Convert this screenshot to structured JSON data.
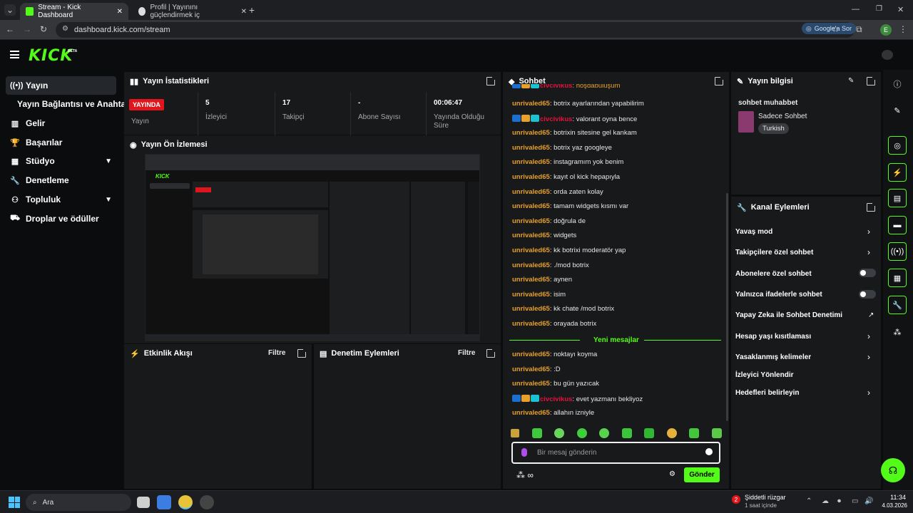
{
  "browser": {
    "tabs": [
      {
        "label": "Stream - Kick Dashboard"
      },
      {
        "label": "Profil | Yayınını güçlendirmek iç"
      }
    ],
    "new_tab": "+",
    "url": "dashboard.kick.com/stream",
    "google_chip": "Google'a Sor",
    "profile_initial": "E"
  },
  "brand": {
    "logo": "KICK",
    "beta": "BETA",
    "accent": "#53fc18"
  },
  "sidebar": {
    "items": [
      {
        "label": "Yayın",
        "icon": "broadcast-icon"
      },
      {
        "label": "Yayın Bağlantısı ve Anahtarı"
      },
      {
        "label": "Gelir",
        "icon": "revenue-icon"
      },
      {
        "label": "Başarılar",
        "icon": "trophy-icon"
      },
      {
        "label": "Stüdyo",
        "icon": "studio-icon"
      },
      {
        "label": "Denetleme",
        "icon": "wrench-icon"
      },
      {
        "label": "Topluluk",
        "icon": "community-icon"
      },
      {
        "label": "Droplar ve ödüller",
        "icon": "drops-icon"
      }
    ]
  },
  "stats": {
    "title": "Yayın İstatistikleri",
    "live_badge": "YAYINDA",
    "live_label": "Yayın",
    "viewers_value": "5",
    "viewers_label": "İzleyici",
    "followers_value": "17",
    "followers_label": "Takipçi",
    "subs_value": "-",
    "subs_label": "Abone Sayısı",
    "uptime_value": "00:06:47",
    "uptime_label": "Yayında Olduğu Süre"
  },
  "preview": {
    "title": "Yayın Ön İzlemesi"
  },
  "activity": {
    "title": "Etkinlik Akışı",
    "filter": "Filtre"
  },
  "moderation": {
    "title": "Denetim Eylemleri",
    "filter": "Filtre"
  },
  "chat": {
    "title": "Sohbet",
    "messages": [
      {
        "user": "unrivaled65",
        "text": ": botrix ayarlarından yapabilirim",
        "badges": false
      },
      {
        "user": "civcivikus",
        "text": ": valorant oyna bence",
        "badges": true
      },
      {
        "user": "unrivaled65",
        "text": ": botrixin sitesine gel kankam",
        "badges": false
      },
      {
        "user": "unrivaled65",
        "text": ": botrix yaz googleye",
        "badges": false
      },
      {
        "user": "unrivaled65",
        "text": ": instagramım yok benim",
        "badges": false
      },
      {
        "user": "unrivaled65",
        "text": ": kayıt ol kick hepapıyla",
        "badges": false
      },
      {
        "user": "unrivaled65",
        "text": ": orda zaten kolay",
        "badges": false
      },
      {
        "user": "unrivaled65",
        "text": ": tamam widgets kısmı var",
        "badges": false
      },
      {
        "user": "unrivaled65",
        "text": ": doğrula de",
        "badges": false
      },
      {
        "user": "unrivaled65",
        "text": ": widgets",
        "badges": false
      },
      {
        "user": "unrivaled65",
        "text": ": kk botrixi moderatör yap",
        "badges": false
      },
      {
        "user": "unrivaled65",
        "text": ": ./mod botrix",
        "badges": false
      },
      {
        "user": "unrivaled65",
        "text": ": aynen",
        "badges": false
      },
      {
        "user": "unrivaled65",
        "text": ": isim",
        "badges": false
      },
      {
        "user": "unrivaled65",
        "text": ": kk chate /mod botrix",
        "badges": false
      },
      {
        "user": "unrivaled65",
        "text": ": orayada botrix",
        "badges": false
      }
    ],
    "new_messages": "Yeni mesajlar",
    "messages_after": [
      {
        "user": "unrivaled65",
        "text": ": noktayı koyma",
        "badges": false
      },
      {
        "user": "unrivaled65",
        "text": ": :D",
        "badges": false
      },
      {
        "user": "unrivaled65",
        "text": ": bu gün yazıcak",
        "badges": false
      },
      {
        "user": "civcivikus",
        "text": ": evet yazmanı bekliyoz",
        "badges": true
      },
      {
        "user": "unrivaled65",
        "text": ": allahın izniyle",
        "badges": false
      }
    ],
    "placeholder": "Bir mesaj gönderin",
    "send": "Gönder"
  },
  "stream_info": {
    "title": "Yayın bilgisi",
    "stream_title": "sohbet muhabbet",
    "category": "Sadece Sohbet",
    "language": "Turkish"
  },
  "channel_actions": {
    "title": "Kanal Eylemleri",
    "items": [
      {
        "label": "Yavaş mod",
        "control": "arrow"
      },
      {
        "label": "Takipçilere özel sohbet",
        "control": "arrow"
      },
      {
        "label": "Abonelere özel sohbet",
        "control": "toggle"
      },
      {
        "label": "Yalnızca ifadelerle sohbet",
        "control": "toggle"
      },
      {
        "label": "Yapay Zeka ile Sohbet Denetimi",
        "control": "external"
      },
      {
        "label": "Hesap yaşı kısıtlaması",
        "control": "arrow"
      },
      {
        "label": "Yasaklanmış kelimeler",
        "control": "arrow"
      },
      {
        "label": "İzleyici Yönlendir",
        "control": "none"
      },
      {
        "label": "Hedefleri belirleyin",
        "control": "arrow"
      }
    ]
  },
  "taskbar": {
    "search": "Ara",
    "weather": "Şiddetli rüzgar",
    "weather_sub": "1 saat içinde",
    "notif_count": "2",
    "time": "11:34",
    "date": "4.03.2026"
  }
}
